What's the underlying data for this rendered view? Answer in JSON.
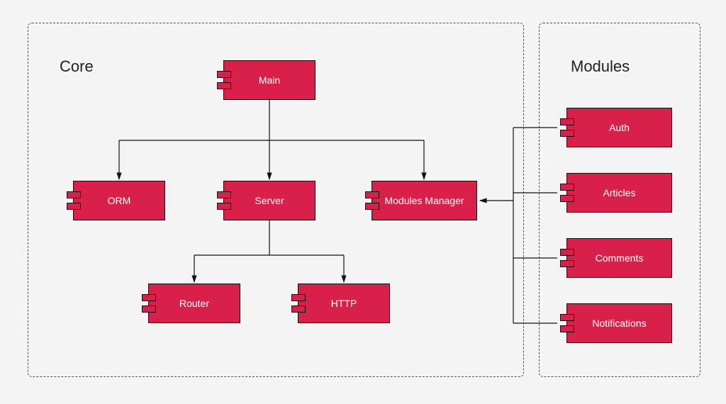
{
  "groups": {
    "core": {
      "title": "Core"
    },
    "modules": {
      "title": "Modules"
    }
  },
  "components": {
    "main": "Main",
    "orm": "ORM",
    "server": "Server",
    "modules_manager": "Modules Manager",
    "router": "Router",
    "http": "HTTP",
    "auth": "Auth",
    "articles": "Articles",
    "comments": "Comments",
    "notifications": "Notifications"
  }
}
